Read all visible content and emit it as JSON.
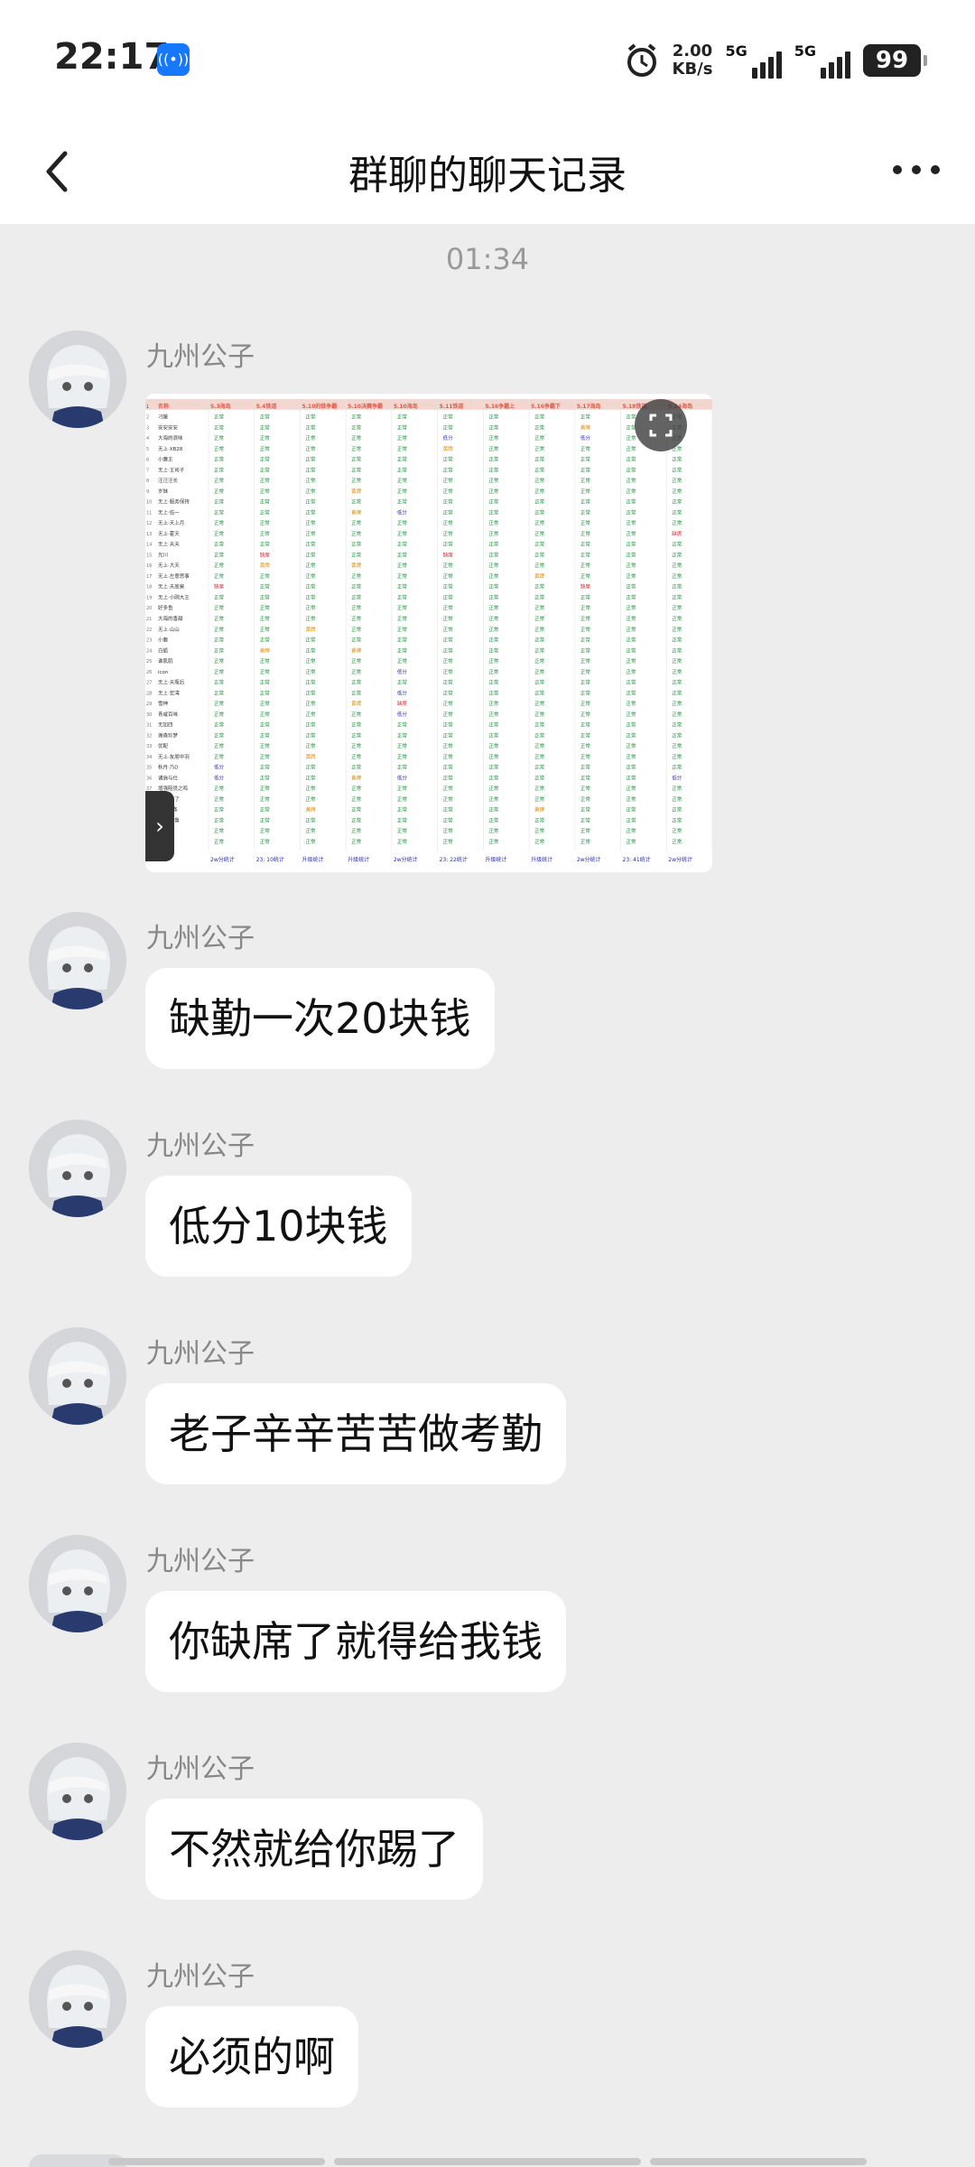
{
  "status_bar": {
    "time": "22:17",
    "speed_value": "2.00",
    "speed_unit": "KB/s",
    "net1": "5G",
    "net2": "5G",
    "battery": "99",
    "icons": [
      "app-notification-icon",
      "alarm-icon",
      "signal-icon",
      "battery-icon"
    ]
  },
  "header": {
    "title": "群聊的聊天记录",
    "back_icon": "back-arrow-icon",
    "more_icon": "more-dots-icon"
  },
  "timestamp": "01:34",
  "attendance_sheet": {
    "col_headers": [
      "名称",
      "5.3海岛",
      "5.4铁道",
      "5.10的铁争霸",
      "5.10决赛争霸",
      "5.10海岛",
      "5.11铁道",
      "5.16争霸上",
      "5.16争霸下",
      "5.17海岛",
      "5.18铁道",
      "5.24海岛"
    ],
    "row_names": [
      "刁媛",
      "安安安安",
      "大海的浪味",
      "无上·XB28",
      "小廉王",
      "无上·王司子",
      "汪汪汪长",
      "岁妹",
      "无上·服务保持",
      "无上·伍一",
      "无上·天上月",
      "无上·霍天",
      "无上·天天",
      "光川",
      "无上·大天",
      "无上·左意思事",
      "无上·天底泉",
      "无上·小刚大王",
      "好多鱼",
      "大海的香甜",
      "无上·山山",
      "小鹿",
      "白狐",
      "谁肌肌",
      "icon",
      "无上·天瓶后",
      "无上·宏湾",
      "雪神",
      "青咸百味",
      "无加四",
      "谢森珍梦",
      "优配",
      "无上·友朋中羽",
      "秋月·乃D",
      "诸逍与仕",
      "增强陪员之鸣",
      "趣·面饭了",
      "小鱼半条",
      "无上·食鲁",
      "",
      "雾语治"
    ],
    "status_normal": "正常",
    "status_absent": "缺席",
    "status_low": "低分",
    "status_yellow": "黄牌",
    "footer": [
      "2w分统计",
      "23: 10统计",
      "升级统计",
      "升级统计",
      "2w分统计",
      "23: 22统计",
      "升级统计",
      "升级统计",
      "2w分统计",
      "23: 41统计",
      "2w分统计"
    ],
    "colors": {
      "normal": "#1a8f3a",
      "absent": "#d0242d",
      "low": "#2a2ab8",
      "yellow": "#e08a00",
      "header": "#e6584a"
    }
  },
  "messages": [
    {
      "sender": "九州公子",
      "type": "image"
    },
    {
      "sender": "九州公子",
      "text": "缺勤一次20块钱"
    },
    {
      "sender": "九州公子",
      "text": "低分10块钱"
    },
    {
      "sender": "九州公子",
      "text": "老子辛辛苦苦做考勤"
    },
    {
      "sender": "九州公子",
      "text": "你缺席了就得给我钱"
    },
    {
      "sender": "九州公子",
      "text": "不然就给你踢了"
    },
    {
      "sender": "九州公子",
      "text": "必须的啊"
    }
  ],
  "colors": {
    "background": "#ededed",
    "bubble": "#ffffff",
    "sender": "#888888"
  }
}
